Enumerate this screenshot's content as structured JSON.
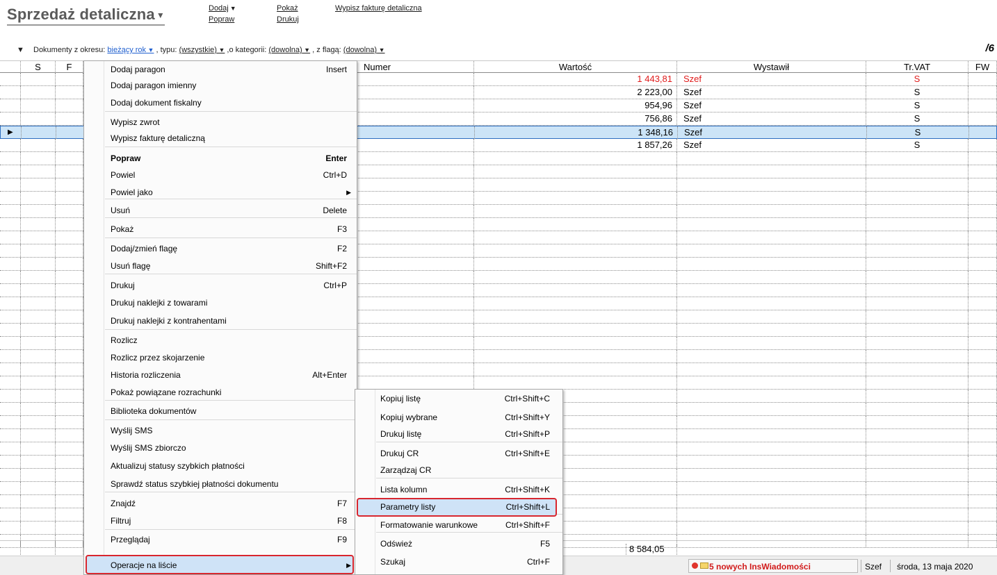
{
  "header": {
    "title": "Sprzedaż detaliczna",
    "links": {
      "dodaj": "Dodaj",
      "popraw": "Popraw",
      "pokaz": "Pokaż",
      "drukuj": "Drukuj",
      "wypisz": "Wypisz fakturę detaliczna"
    }
  },
  "filter": {
    "prefix": "Dokumenty z okresu:",
    "period": "bieżący rok",
    "type_label": ", typu:",
    "type_value": "(wszystkie)",
    "category_label": ",o kategorii:",
    "category_value": "(dowolna)",
    "flag_label": ", z flagą:",
    "flag_value": "(dowolna)"
  },
  "count": "/6",
  "table": {
    "columns": [
      "S",
      "F",
      "",
      "Numer",
      "Wartość",
      "Wystawił",
      "Tr.VAT",
      "FW"
    ],
    "rows": [
      {
        "value": "1 443,81",
        "issuer": "Szef",
        "vat": "S",
        "red": true
      },
      {
        "value": "2 223,00",
        "issuer": "Szef",
        "vat": "S",
        "red": false
      },
      {
        "value": "954,96",
        "issuer": "Szef",
        "vat": "S",
        "red": false
      },
      {
        "value": "756,86",
        "issuer": "Szef",
        "vat": "S",
        "red": false
      },
      {
        "value": "1 348,16",
        "issuer": "Szef",
        "vat": "S",
        "red": false,
        "selected": true
      },
      {
        "value": "1 857,26",
        "issuer": "Szef",
        "vat": "S",
        "red": false
      }
    ],
    "total": "8 584,05"
  },
  "context_menu": {
    "items": [
      {
        "label": "Dodaj paragon",
        "shortcut": "Insert"
      },
      {
        "label": "Dodaj paragon imienny",
        "shortcut": ""
      },
      {
        "label": "Dodaj dokument fiskalny",
        "shortcut": ""
      },
      {
        "label": "Wypisz zwrot",
        "shortcut": ""
      },
      {
        "label": "Wypisz fakturę detaliczną",
        "shortcut": ""
      },
      {
        "label": "Popraw",
        "shortcut": "Enter"
      },
      {
        "label": "Powiel",
        "shortcut": "Ctrl+D"
      },
      {
        "label": "Powiel jako",
        "shortcut": ""
      },
      {
        "label": "Usuń",
        "shortcut": "Delete"
      },
      {
        "label": "Pokaż",
        "shortcut": "F3"
      },
      {
        "label": "Dodaj/zmień flagę",
        "shortcut": "F2"
      },
      {
        "label": "Usuń flagę",
        "shortcut": "Shift+F2"
      },
      {
        "label": "Drukuj",
        "shortcut": "Ctrl+P"
      },
      {
        "label": "Drukuj naklejki z towarami",
        "shortcut": ""
      },
      {
        "label": "Drukuj naklejki z kontrahentami",
        "shortcut": ""
      },
      {
        "label": "Rozlicz",
        "shortcut": ""
      },
      {
        "label": "Rozlicz przez skojarzenie",
        "shortcut": ""
      },
      {
        "label": "Historia rozliczenia",
        "shortcut": "Alt+Enter"
      },
      {
        "label": "Pokaż powiązane rozrachunki",
        "shortcut": ""
      },
      {
        "label": "Biblioteka dokumentów",
        "shortcut": ""
      },
      {
        "label": "Wyślij SMS",
        "shortcut": ""
      },
      {
        "label": "Wyślij SMS zbiorczo",
        "shortcut": ""
      },
      {
        "label": "Aktualizuj statusy szybkich płatności",
        "shortcut": ""
      },
      {
        "label": "Sprawdź status szybkiej płatności dokumentu",
        "shortcut": ""
      },
      {
        "label": "Znajdź",
        "shortcut": "F7"
      },
      {
        "label": "Filtruj",
        "shortcut": "F8"
      },
      {
        "label": "Przeglądaj",
        "shortcut": "F9"
      },
      {
        "label": "Operacje na liście",
        "shortcut": ""
      }
    ]
  },
  "submenu": {
    "items": [
      {
        "label": "Kopiuj listę",
        "shortcut": "Ctrl+Shift+C"
      },
      {
        "label": "Kopiuj wybrane",
        "shortcut": "Ctrl+Shift+Y"
      },
      {
        "label": "Drukuj listę",
        "shortcut": "Ctrl+Shift+P"
      },
      {
        "label": "Drukuj CR",
        "shortcut": "Ctrl+Shift+E"
      },
      {
        "label": "Zarządzaj CR",
        "shortcut": ""
      },
      {
        "label": "Lista kolumn",
        "shortcut": "Ctrl+Shift+K"
      },
      {
        "label": "Parametry listy",
        "shortcut": "Ctrl+Shift+L"
      },
      {
        "label": "Formatowanie warunkowe",
        "shortcut": "Ctrl+Shift+F"
      },
      {
        "label": "Odśwież",
        "shortcut": "F5"
      },
      {
        "label": "Szukaj",
        "shortcut": "Ctrl+F"
      }
    ]
  },
  "status": {
    "messages": "5 nowych InsWiadomości",
    "user": "Szef",
    "date": "środa, 13 maja 2020",
    "colors": {
      "red": "#e0342c",
      "green": "#3cc43c",
      "accent": "#d8262e"
    }
  }
}
